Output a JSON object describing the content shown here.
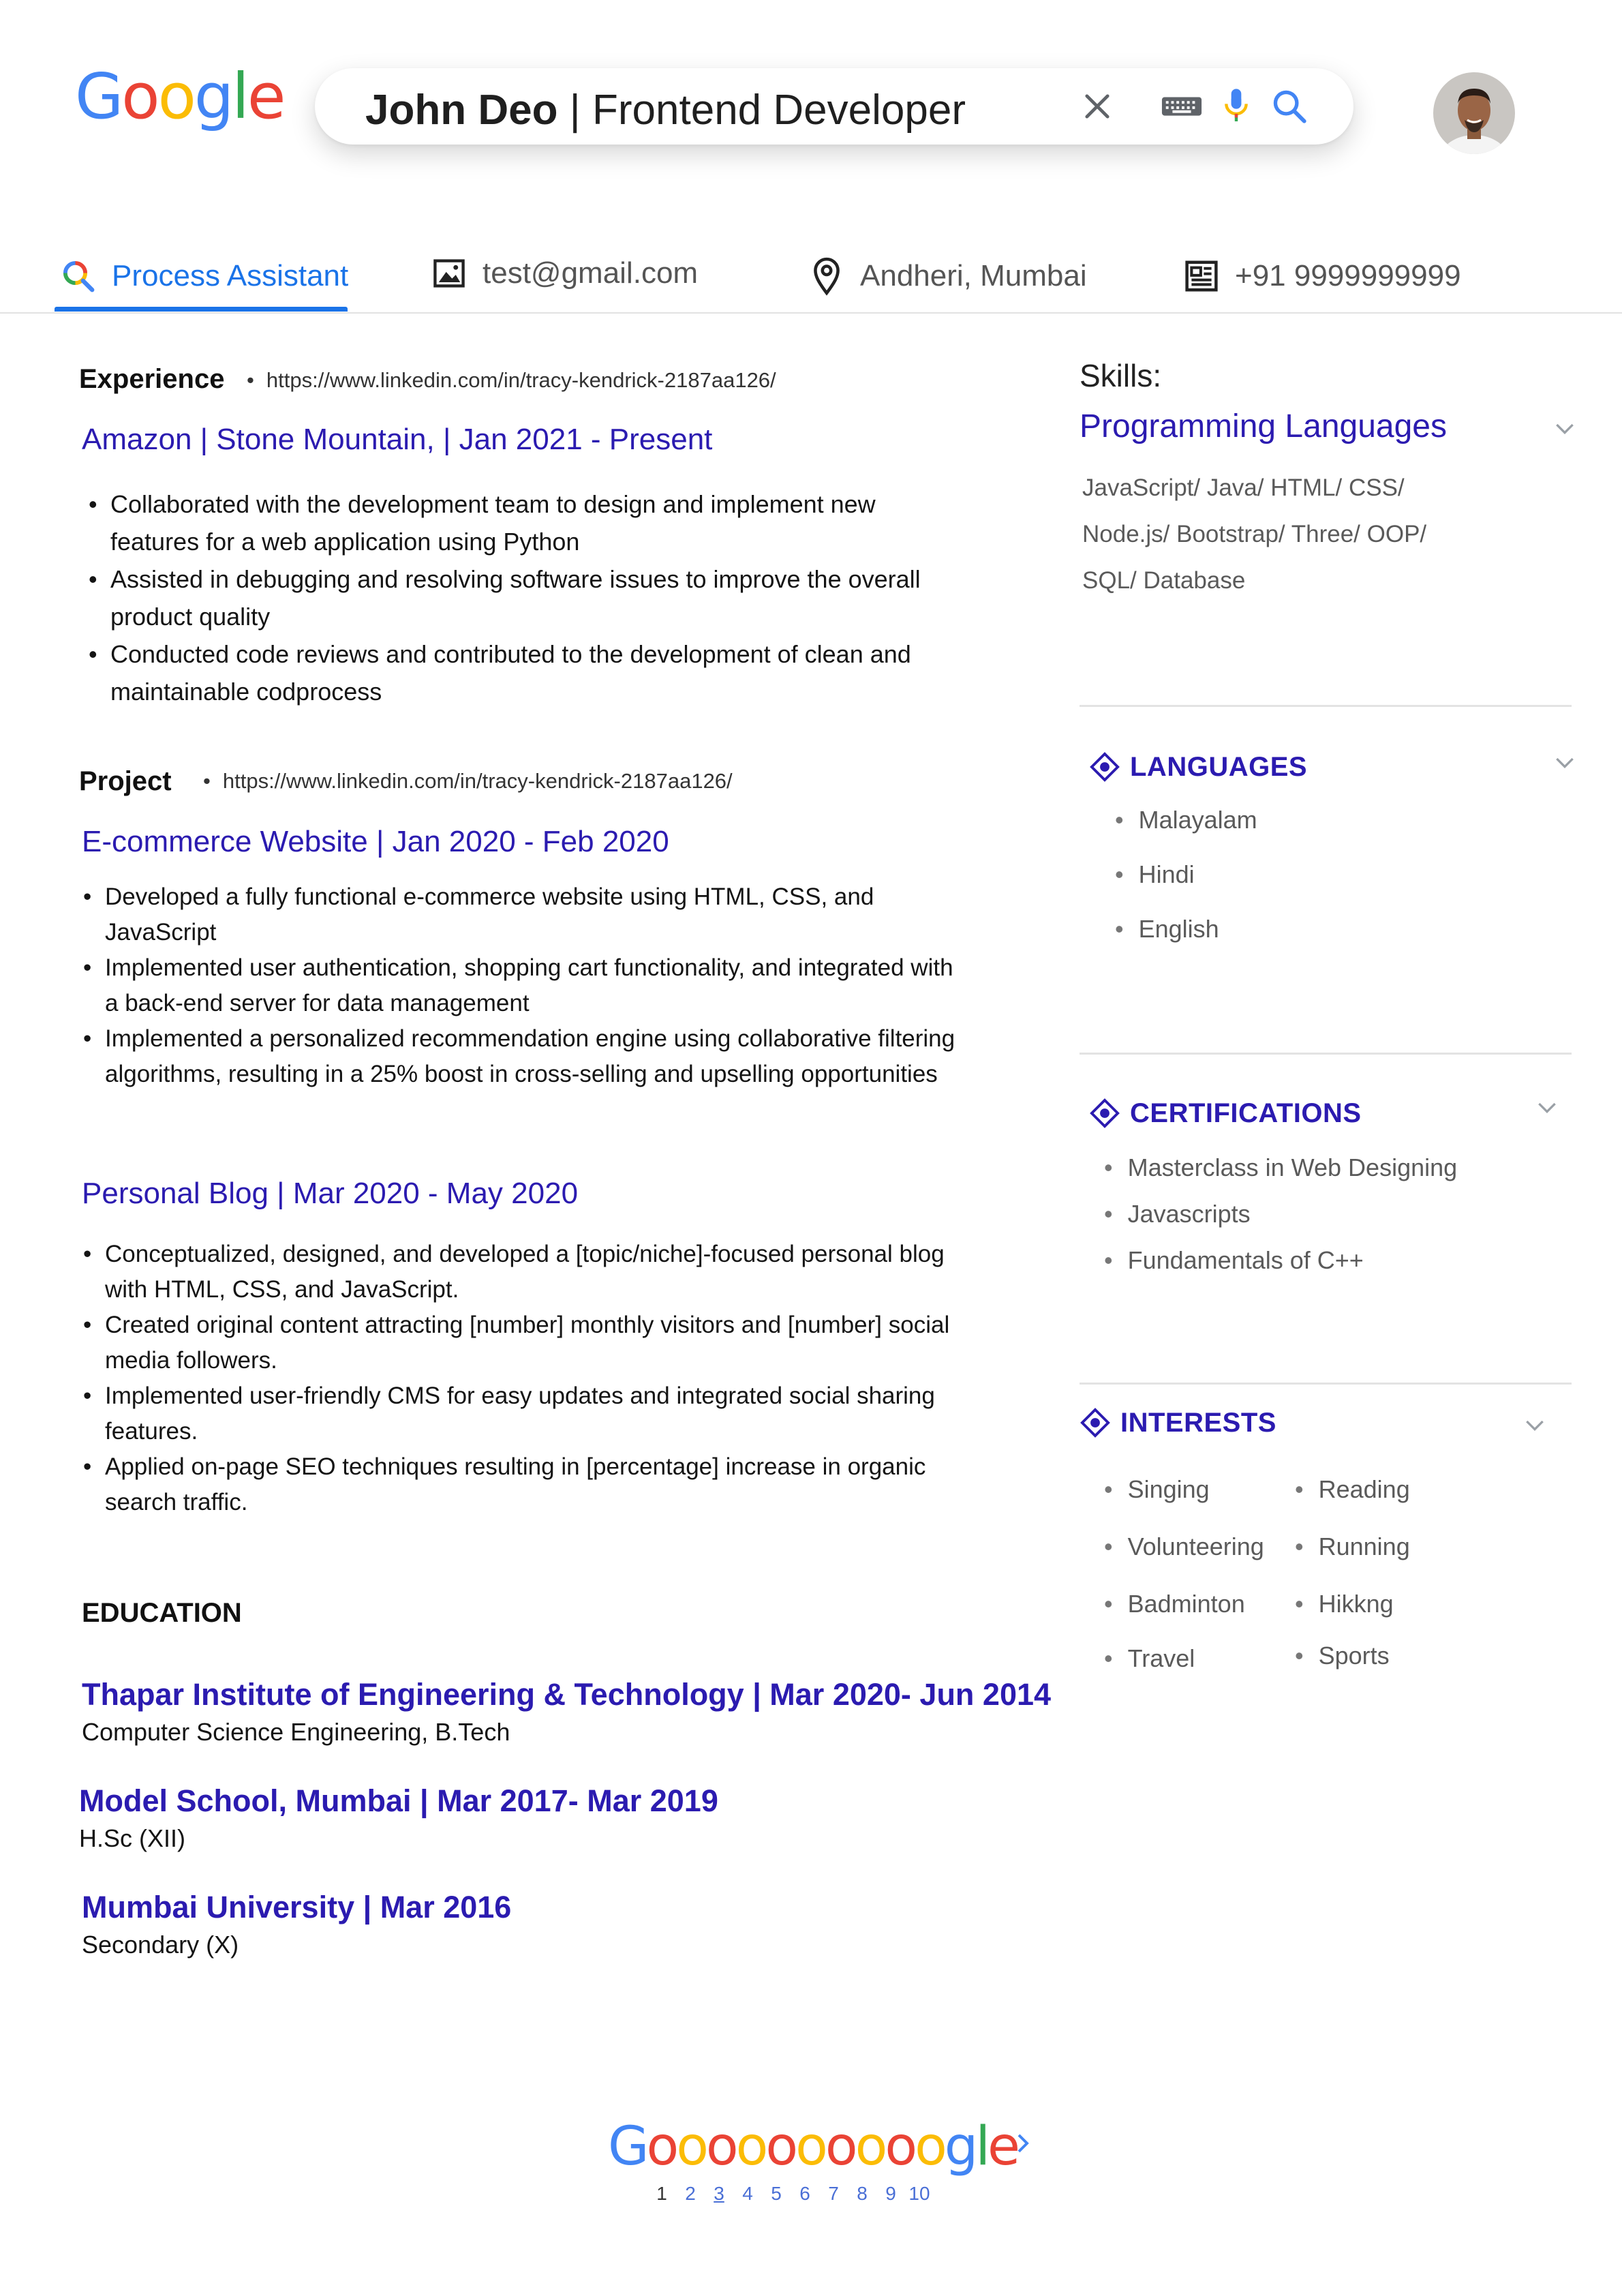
{
  "header": {
    "logo_letters": [
      "G",
      "o",
      "o",
      "g",
      "l",
      "e"
    ],
    "logo_colors": [
      "#4285F4",
      "#EA4335",
      "#FBBC05",
      "#4285F4",
      "#34A853",
      "#EA4335"
    ],
    "search": {
      "name": "John Deo",
      "separator": " | ",
      "role": "Frontend Developer"
    },
    "icons": [
      "close-icon",
      "keyboard-icon",
      "microphone-icon",
      "search-icon"
    ],
    "avatar": "profile-photo"
  },
  "tabs": [
    {
      "label": "Process Assistant",
      "icon": "google-search-icon"
    },
    {
      "label": "test@gmail.com",
      "icon": "image-icon"
    },
    {
      "label": "Andheri, Mumbai",
      "icon": "location-pin-icon"
    },
    {
      "label": "+91 9999999999",
      "icon": "news-icon"
    }
  ],
  "experience": {
    "label": "Experience",
    "link": "https://www.linkedin.com/in/tracy-kendrick-2187aa126/",
    "title": "Amazon | Stone Mountain, |  Jan 2021 - Present",
    "bullets": [
      "Collaborated with the development team to design and implement new features for a web application using Python",
      "Assisted in debugging and resolving software issues to improve the overall product quality",
      "Conducted code reviews and contributed to the development of clean and maintainable codprocess"
    ]
  },
  "project": {
    "label": "Project",
    "link": "https://www.linkedin.com/in/tracy-kendrick-2187aa126/",
    "items": [
      {
        "title": "E-commerce Website | Jan 2020 - Feb 2020",
        "bullets": [
          "Developed a fully functional e-commerce website using HTML, CSS, and JavaScript",
          "Implemented user authentication, shopping cart functionality, and integrated with a back-end server for data management",
          "Implemented a personalized recommendation engine using collaborative filtering algorithms, resulting in a 25% boost in cross-selling and upselling opportunities"
        ]
      },
      {
        "title": "Personal Blog | Mar 2020 - May 2020",
        "bullets": [
          "Conceptualized, designed, and developed a [topic/niche]-focused personal blog with HTML, CSS, and JavaScript.",
          "Created original content attracting [number] monthly visitors and [number] social media followers.",
          "Implemented user-friendly CMS for easy updates and integrated social sharing features.",
          "Applied on-page SEO techniques resulting in [percentage] increase in organic search traffic."
        ]
      }
    ]
  },
  "education": {
    "label": "EDUCATION",
    "items": [
      {
        "title": "Thapar Institute of Engineering & Technology | Mar 2020- Jun 2014",
        "sub": "Computer Science Engineering, B.Tech"
      },
      {
        "title": "Model School, Mumbai | Mar 2017- Mar 2019",
        "sub": "H.Sc (XII)"
      },
      {
        "title": "Mumbai University | Mar 2016",
        "sub": "Secondary (X)"
      }
    ]
  },
  "skills": {
    "label": "Skills:",
    "title": "Programming Languages",
    "lines": [
      "JavaScript/ Java/ HTML/ CSS/",
      "Node.js/ Bootstrap/ Three/ OOP/",
      "SQL/ Database"
    ]
  },
  "languages": {
    "title": "LANGUAGES",
    "items": [
      "Malayalam",
      "Hindi",
      "English"
    ]
  },
  "certifications": {
    "title": "CERTIFICATIONS",
    "items": [
      "Masterclass in Web Designing",
      "Javascripts",
      "Fundamentals of C++"
    ]
  },
  "interests": {
    "title": "INTERESTS",
    "col1": [
      "Singing",
      "Volunteering",
      "Badminton",
      "Travel"
    ],
    "col2": [
      "Reading",
      "Running",
      "Hikkng",
      "Sports"
    ]
  },
  "paginator": {
    "logo_text": "Goooooooooogle",
    "pages": [
      "1",
      "2",
      "3",
      "4",
      "5",
      "6",
      "7",
      "8",
      "9",
      "10"
    ],
    "current_page": "1"
  },
  "colors": {
    "accent_blue": "#1a73e8",
    "heading_indigo": "#2b1bb0",
    "muted_text": "#5a5a5a"
  }
}
